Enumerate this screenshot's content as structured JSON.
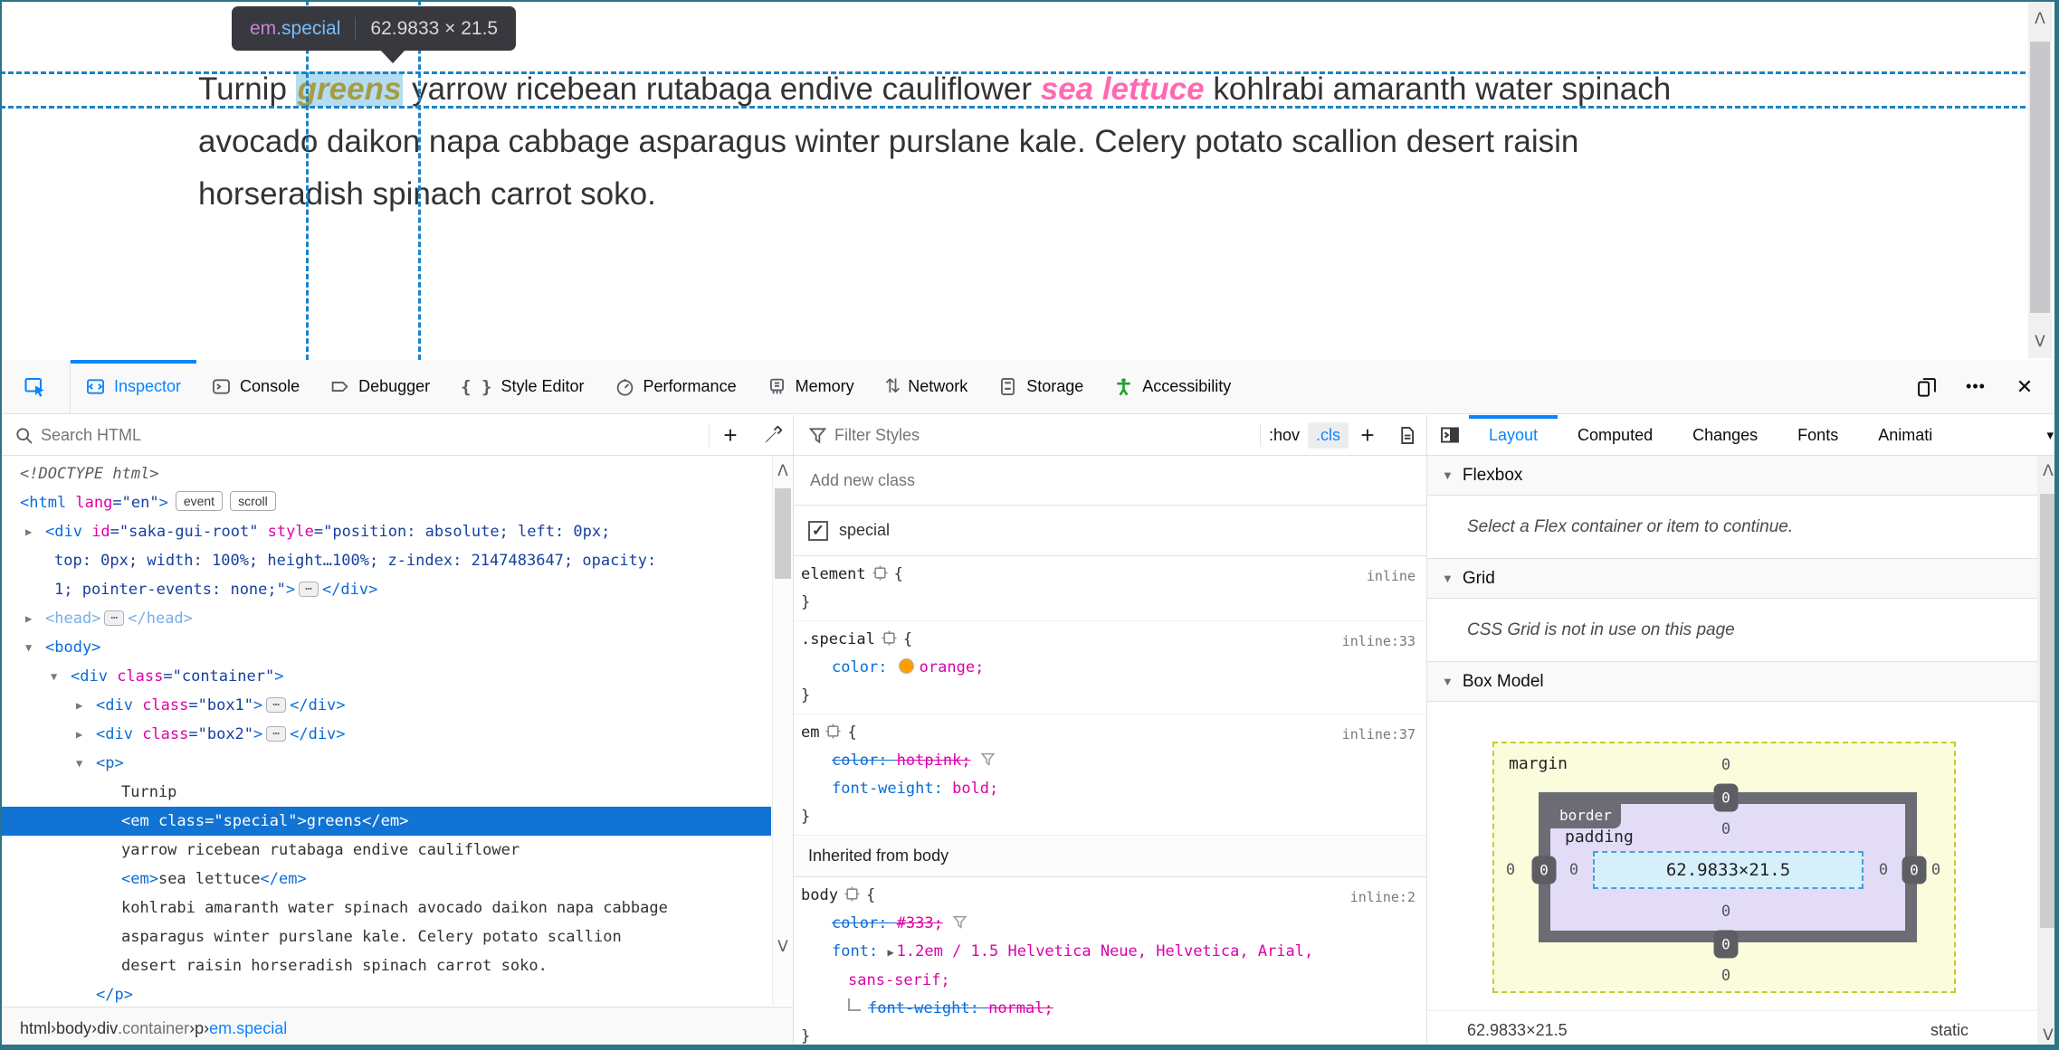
{
  "accent": "#0a84ff",
  "window_frame_color": "#2b7586",
  "overlay": {
    "tooltip": {
      "tag": "em",
      "class": ".special",
      "dims": "62.9833 × 21.5"
    }
  },
  "page": {
    "lines": [
      [
        {
          "t": "Turnip ",
          "s": "plain"
        },
        {
          "t": "greens",
          "s": "special"
        },
        {
          "t": " yarrow ricebean rutabaga endive cauliflower ",
          "s": "plain"
        },
        {
          "t": "sea lettuce",
          "s": "em"
        },
        {
          "t": " kohlrabi amaranth water spinach",
          "s": "plain"
        }
      ],
      [
        {
          "t": "avocado daikon napa cabbage asparagus winter purslane kale. Celery potato scallion desert raisin",
          "s": "plain"
        }
      ],
      [
        {
          "t": "horseradish spinach carrot soko.",
          "s": "plain"
        }
      ]
    ]
  },
  "toolbar": {
    "tabs": [
      {
        "label": "Inspector",
        "icon": "inspector",
        "active": true
      },
      {
        "label": "Console",
        "icon": "console",
        "active": false
      },
      {
        "label": "Debugger",
        "icon": "debugger",
        "active": false
      },
      {
        "label": "Style Editor",
        "icon": "braces",
        "active": false
      },
      {
        "label": "Performance",
        "icon": "performance",
        "active": false
      },
      {
        "label": "Memory",
        "icon": "memory",
        "active": false
      },
      {
        "label": "Network",
        "icon": "network",
        "active": false
      },
      {
        "label": "Storage",
        "icon": "storage",
        "active": false
      },
      {
        "label": "Accessibility",
        "icon": "accessibility",
        "active": false,
        "icon_color": "#21a22c"
      }
    ],
    "right_icons": [
      {
        "name": "responsive-mode-icon",
        "glyph": "responsive"
      },
      {
        "name": "more-menu-icon",
        "glyph": "dots"
      },
      {
        "name": "close-icon",
        "glyph": "close"
      }
    ]
  },
  "markup_panel": {
    "search_placeholder": "Search HTML",
    "rows": [
      {
        "ind": 22,
        "parts": [
          {
            "t": "<!DOCTYPE html>",
            "c": "d"
          }
        ]
      },
      {
        "ind": 22,
        "parts": [
          {
            "t": "<html",
            "c": "g"
          },
          {
            "t": " lang",
            "c": "a"
          },
          {
            "t": "=\"en\"",
            "c": "v"
          },
          {
            "t": ">",
            "c": "g"
          }
        ],
        "badges": [
          "event",
          "scroll"
        ]
      },
      {
        "ind": 50,
        "exp": "h",
        "parts": [
          {
            "t": "<div",
            "c": "g"
          },
          {
            "t": " id",
            "c": "a"
          },
          {
            "t": "=\"saka-gui-root\"",
            "c": "v"
          },
          {
            "t": " style",
            "c": "a"
          },
          {
            "t": "=\"position: absolute; left: 0px;",
            "c": "v"
          }
        ]
      },
      {
        "ind": 60,
        "parts": [
          {
            "t": "top: 0px; width: 100%; height…100%; z-index: 2147483647; opacity:",
            "c": "v"
          }
        ]
      },
      {
        "ind": 60,
        "parts": [
          {
            "t": "1; pointer-events: none;\"",
            "c": "v"
          },
          {
            "t": ">",
            "c": "g"
          },
          {
            "t": "⋯",
            "c": "e"
          },
          {
            "t": "</div>",
            "c": "g"
          }
        ]
      },
      {
        "ind": 50,
        "exp": "h",
        "muted": true,
        "parts": [
          {
            "t": "<head>",
            "c": "g"
          },
          {
            "t": "⋯",
            "c": "e"
          },
          {
            "t": "</head>",
            "c": "g"
          }
        ]
      },
      {
        "ind": 50,
        "exp": "v",
        "parts": [
          {
            "t": "<body>",
            "c": "g"
          }
        ]
      },
      {
        "ind": 78,
        "exp": "v",
        "parts": [
          {
            "t": "<div",
            "c": "g"
          },
          {
            "t": " class",
            "c": "a"
          },
          {
            "t": "=\"container\"",
            "c": "v"
          },
          {
            "t": ">",
            "c": "g"
          }
        ]
      },
      {
        "ind": 106,
        "exp": "h",
        "parts": [
          {
            "t": "<div",
            "c": "g"
          },
          {
            "t": " class",
            "c": "a"
          },
          {
            "t": "=\"box1\"",
            "c": "v"
          },
          {
            "t": ">",
            "c": "g"
          },
          {
            "t": "⋯",
            "c": "e"
          },
          {
            "t": "</div>",
            "c": "g"
          }
        ]
      },
      {
        "ind": 106,
        "exp": "h",
        "parts": [
          {
            "t": "<div",
            "c": "g"
          },
          {
            "t": " class",
            "c": "a"
          },
          {
            "t": "=\"box2\"",
            "c": "v"
          },
          {
            "t": ">",
            "c": "g"
          },
          {
            "t": "⋯",
            "c": "e"
          },
          {
            "t": "</div>",
            "c": "g"
          }
        ]
      },
      {
        "ind": 106,
        "exp": "v",
        "parts": [
          {
            "t": "<p>",
            "c": "g"
          }
        ]
      },
      {
        "ind": 134,
        "parts": [
          {
            "t": "Turnip",
            "c": "t"
          }
        ]
      },
      {
        "ind": 134,
        "sel": true,
        "parts": [
          {
            "t": "<em",
            "c": "g"
          },
          {
            "t": " class",
            "c": "a"
          },
          {
            "t": "=\"special\"",
            "c": "v"
          },
          {
            "t": ">",
            "c": "g"
          },
          {
            "t": "greens",
            "c": "t"
          },
          {
            "t": "</em>",
            "c": "g"
          }
        ]
      },
      {
        "ind": 134,
        "parts": [
          {
            "t": "yarrow ricebean rutabaga endive cauliflower",
            "c": "t"
          }
        ]
      },
      {
        "ind": 134,
        "parts": [
          {
            "t": "<em>",
            "c": "g"
          },
          {
            "t": "sea lettuce",
            "c": "t"
          },
          {
            "t": "</em>",
            "c": "g"
          }
        ]
      },
      {
        "ind": 134,
        "parts": [
          {
            "t": "kohlrabi amaranth water spinach avocado daikon napa cabbage",
            "c": "t"
          }
        ]
      },
      {
        "ind": 134,
        "parts": [
          {
            "t": "asparagus winter purslane kale. Celery potato scallion",
            "c": "t"
          }
        ]
      },
      {
        "ind": 134,
        "parts": [
          {
            "t": "desert raisin horseradish spinach carrot soko.",
            "c": "t"
          }
        ]
      },
      {
        "ind": 106,
        "parts": [
          {
            "t": "</p>",
            "c": "g"
          }
        ]
      }
    ],
    "breadcrumbs": [
      {
        "label": "html"
      },
      {
        "label": "body"
      },
      {
        "label": "div",
        "cls": ".container"
      },
      {
        "label": "p"
      },
      {
        "label": "em",
        "cls": ".special",
        "selected": true
      }
    ]
  },
  "rules_panel": {
    "filter_placeholder": "Filter Styles",
    "pseudo_button": ":hov",
    "class_button": ".cls",
    "add_class_placeholder": "Add new class",
    "class_toggle": {
      "checked": true,
      "label": "special"
    },
    "rules": [
      {
        "selector": "element",
        "loc": "inline",
        "props": []
      },
      {
        "selector": ".special",
        "loc": "inline:33",
        "props": [
          {
            "n": "color",
            "v": "orange",
            "swatch": "#ff9e01"
          }
        ]
      },
      {
        "selector": "em",
        "loc": "inline:37",
        "props": [
          {
            "n": "color",
            "v": "hotpink",
            "struck": true,
            "funnel": true
          },
          {
            "n": "font-weight",
            "v": "bold"
          }
        ]
      }
    ],
    "inherited_header": "Inherited from body",
    "inherited_rules": [
      {
        "selector": "body",
        "loc": "inline:2",
        "props": [
          {
            "n": "color",
            "v": "#333",
            "struck": true,
            "funnel": true
          },
          {
            "n": "font",
            "v": "1.2em / 1.5 Helvetica Neue, Helvetica, Arial,",
            "v2": "sans-serif;",
            "expand": true,
            "nosemi": true
          },
          {
            "n": "font-weight",
            "v": "normal",
            "struck": true,
            "child": true
          }
        ]
      }
    ]
  },
  "layout_panel": {
    "tabs": [
      {
        "label": "Layout",
        "active": true
      },
      {
        "label": "Computed",
        "active": false
      },
      {
        "label": "Changes",
        "active": false
      },
      {
        "label": "Fonts",
        "active": false
      },
      {
        "label": "Animati",
        "active": false
      }
    ],
    "sections": [
      {
        "title": "Flexbox",
        "message": "Select a Flex container or item to continue."
      },
      {
        "title": "Grid",
        "message": "CSS Grid is not in use on this page"
      },
      {
        "title": "Box Model",
        "message": null
      }
    ],
    "box_model": {
      "margin_label": "margin",
      "border_label": "border",
      "padding_label": "padding",
      "content": "62.9833×21.5",
      "margin": {
        "top": "0",
        "right": "0",
        "bottom": "0",
        "left": "0"
      },
      "border": {
        "top": "0",
        "right": "0",
        "bottom": "0",
        "left": "0"
      },
      "padding": {
        "top": "0",
        "right": "0",
        "bottom": "0",
        "left": "0"
      }
    },
    "footer": {
      "dimensions": "62.9833×21.5",
      "position": "static"
    }
  }
}
